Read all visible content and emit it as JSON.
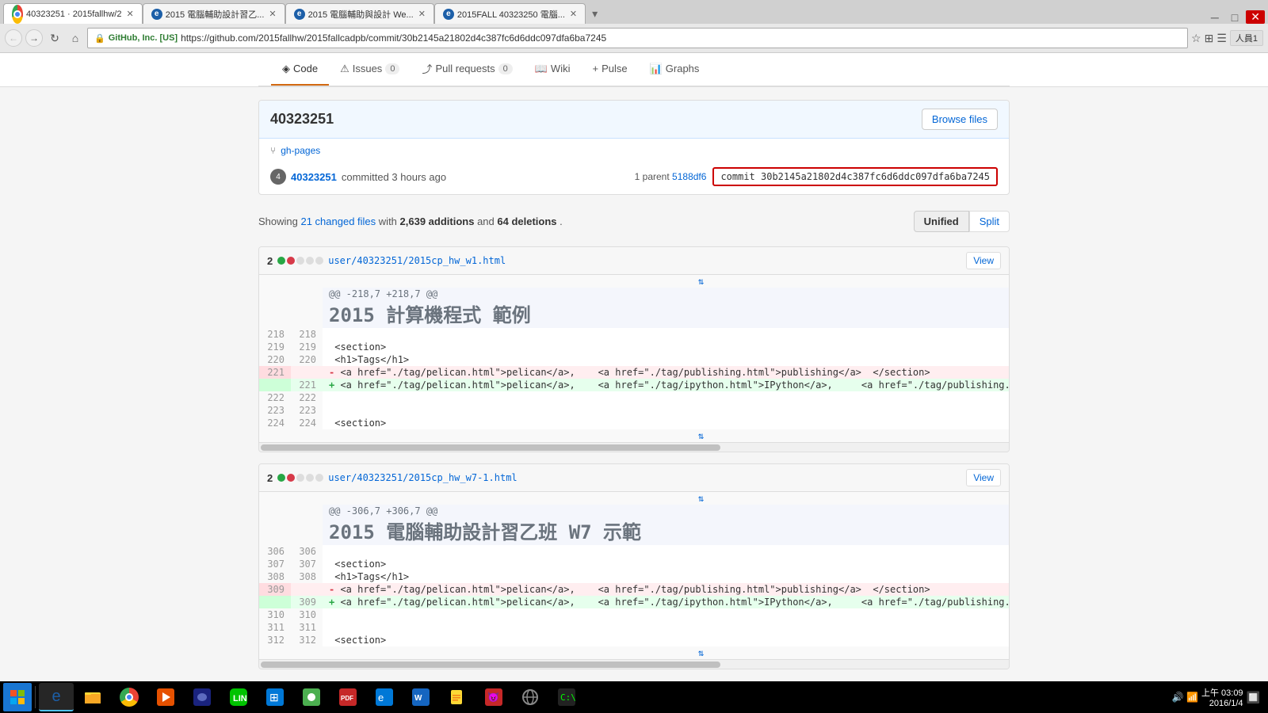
{
  "browser": {
    "tabs": [
      {
        "id": "tab1",
        "label": "40323251 · 2015fallhw/2",
        "active": true,
        "icon": "chrome"
      },
      {
        "id": "tab2",
        "label": "2015 電腦輔助設計習乙...",
        "active": false,
        "icon": "ie"
      },
      {
        "id": "tab3",
        "label": "2015 電腦輔助與設計 We...",
        "active": false,
        "icon": "ie"
      },
      {
        "id": "tab4",
        "label": "2015FALL 40323250 電腦...",
        "active": false,
        "icon": "ie"
      }
    ],
    "url": "https://github.com/2015fallhw/2015fallcadpb/commit/30b2145a21802d4c387fc6d6ddc097dfa6ba7245",
    "lock_label": "GitHub, Inc. [US]",
    "user_badge": "人員1"
  },
  "nav": {
    "items": [
      {
        "label": "Code",
        "icon": "◈",
        "active": true,
        "count": null
      },
      {
        "label": "Issues",
        "active": false,
        "count": "0"
      },
      {
        "label": "Pull requests",
        "active": false,
        "count": "0"
      },
      {
        "label": "Wiki",
        "active": false,
        "count": null
      },
      {
        "label": "Pulse",
        "active": false,
        "count": null
      },
      {
        "label": "Graphs",
        "active": false,
        "count": null
      }
    ]
  },
  "commit": {
    "hash_short": "40323251",
    "branch": "gh-pages",
    "author": "40323251",
    "action": "committed 3 hours ago",
    "parent_count": "1 parent",
    "parent_hash": "5188df6",
    "full_hash": "commit 30b2145a21802d4c387fc6d6ddc097dfa6ba7245",
    "browse_files_label": "Browse files"
  },
  "stats": {
    "text_prefix": "Showing",
    "changed_files": "21 changed files",
    "additions": "2,639 additions",
    "deletions": "64 deletions",
    "view_buttons": [
      "Unified",
      "Split"
    ]
  },
  "diff_files": [
    {
      "num": "2",
      "filepath": "user/40323251/2015cp_hw_w1.html",
      "hunk_header": "@@ -218,7 +218,7 @@ <h1 class=\"entry-title\">2015 計算機程式 範例</h1>",
      "lines": [
        {
          "old": "218",
          "new": "218",
          "type": "normal",
          "content": ""
        },
        {
          "old": "219",
          "new": "219",
          "type": "normal",
          "content": "    <section>"
        },
        {
          "old": "220",
          "new": "220",
          "type": "normal",
          "content": "    <h1>Tags</h1>"
        },
        {
          "old": "221",
          "new": "",
          "type": "removed",
          "content": "     -      <a href=\"./tag/pelican.html\">pelican</a>,    <a href=\"./tag/publishing.html\">publishing</a>  </section>"
        },
        {
          "old": "",
          "new": "221",
          "type": "added",
          "content": "     +      <a href=\"./tag/pelican.html\">pelican</a>,    <a href=\"./tag/ipython.html\">IPython</a>,     <a href=\"./tag/publishing.html\">publi"
        },
        {
          "old": "222",
          "new": "222",
          "type": "normal",
          "content": ""
        },
        {
          "old": "223",
          "new": "223",
          "type": "normal",
          "content": ""
        },
        {
          "old": "224",
          "new": "224",
          "type": "normal",
          "content": "    <section>"
        }
      ]
    },
    {
      "num": "2",
      "filepath": "user/40323251/2015cp_hw_w7-1.html",
      "hunk_header": "@@ -306,7 +306,7 @@ <h1 class=\"entry-title\">2015 電腦輔助設計習乙班 W7 示範</h1>",
      "lines": [
        {
          "old": "306",
          "new": "306",
          "type": "normal",
          "content": ""
        },
        {
          "old": "307",
          "new": "307",
          "type": "normal",
          "content": "    <section>"
        },
        {
          "old": "308",
          "new": "308",
          "type": "normal",
          "content": "    <h1>Tags</h1>"
        },
        {
          "old": "309",
          "new": "",
          "type": "removed",
          "content": "     -      <a href=\"./tag/pelican.html\">pelican</a>,    <a href=\"./tag/publishing.html\">publishing</a>  </section>"
        },
        {
          "old": "",
          "new": "309",
          "type": "added",
          "content": "     +      <a href=\"./tag/pelican.html\">pelican</a>,    <a href=\"./tag/ipython.html\">IPython</a>,     <a href=\"./tag/publishing.html\">publi"
        },
        {
          "old": "310",
          "new": "310",
          "type": "normal",
          "content": ""
        },
        {
          "old": "311",
          "new": "311",
          "type": "normal",
          "content": ""
        },
        {
          "old": "312",
          "new": "312",
          "type": "normal",
          "content": "    <section>"
        }
      ]
    }
  ],
  "taskbar": {
    "clock_time": "上午 03:09",
    "clock_date": "2016/1/4"
  }
}
